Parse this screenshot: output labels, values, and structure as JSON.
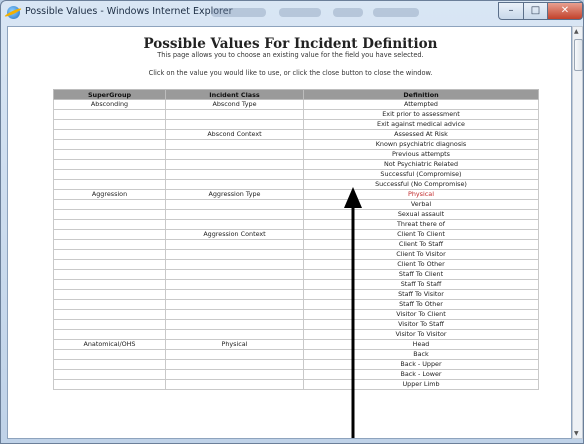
{
  "window": {
    "title": "Possible Values - Windows Internet Explorer",
    "minimize_label": "–",
    "maximize_label": "□",
    "close_label": "✕"
  },
  "page": {
    "heading": "Possible Values For Incident Definition",
    "subtitle": "This page allows you to choose an existing value for the field you have selected.",
    "instruction": "Click on the value you would like to use, or click the close button to close the window."
  },
  "table": {
    "headers": [
      "SuperGroup",
      "Incident Class",
      "Definition"
    ],
    "rows": [
      [
        "Absconding",
        "Abscond Type",
        "Attempted"
      ],
      [
        "",
        "",
        "Exit prior to assessment"
      ],
      [
        "",
        "",
        "Exit against medical advice"
      ],
      [
        "",
        "Abscond Context",
        "Assessed At Risk"
      ],
      [
        "",
        "",
        "Known psychiatric diagnosis"
      ],
      [
        "",
        "",
        "Previous attempts"
      ],
      [
        "",
        "",
        "Not Psychiatric Related"
      ],
      [
        "",
        "",
        "Successful (Compromise)"
      ],
      [
        "",
        "",
        "Successful (No Compromise)"
      ],
      [
        "Aggression",
        "Aggression Type",
        "Physical"
      ],
      [
        "",
        "",
        "Verbal"
      ],
      [
        "",
        "",
        "Sexual assault"
      ],
      [
        "",
        "",
        "Threat there of"
      ],
      [
        "",
        "Aggression Context",
        "Client To Client"
      ],
      [
        "",
        "",
        "Client To Staff"
      ],
      [
        "",
        "",
        "Client To Visitor"
      ],
      [
        "",
        "",
        "Client To Other"
      ],
      [
        "",
        "",
        "Staff To Client"
      ],
      [
        "",
        "",
        "Staff To Staff"
      ],
      [
        "",
        "",
        "Staff To Visitor"
      ],
      [
        "",
        "",
        "Staff To Other"
      ],
      [
        "",
        "",
        "Visitor To Client"
      ],
      [
        "",
        "",
        "Visitor To Staff"
      ],
      [
        "",
        "",
        "Visitor To Visitor"
      ],
      [
        "Anatomical/OHS",
        "Physical",
        "Head"
      ],
      [
        "",
        "",
        "Back"
      ],
      [
        "",
        "",
        "Back - Upper"
      ],
      [
        "",
        "",
        "Back - Lower"
      ],
      [
        "",
        "",
        "Upper Limb"
      ]
    ],
    "highlighted_row": 9
  },
  "colors": {
    "header_bg": "#9a9a9a",
    "highlight_text": "#c0282a"
  }
}
